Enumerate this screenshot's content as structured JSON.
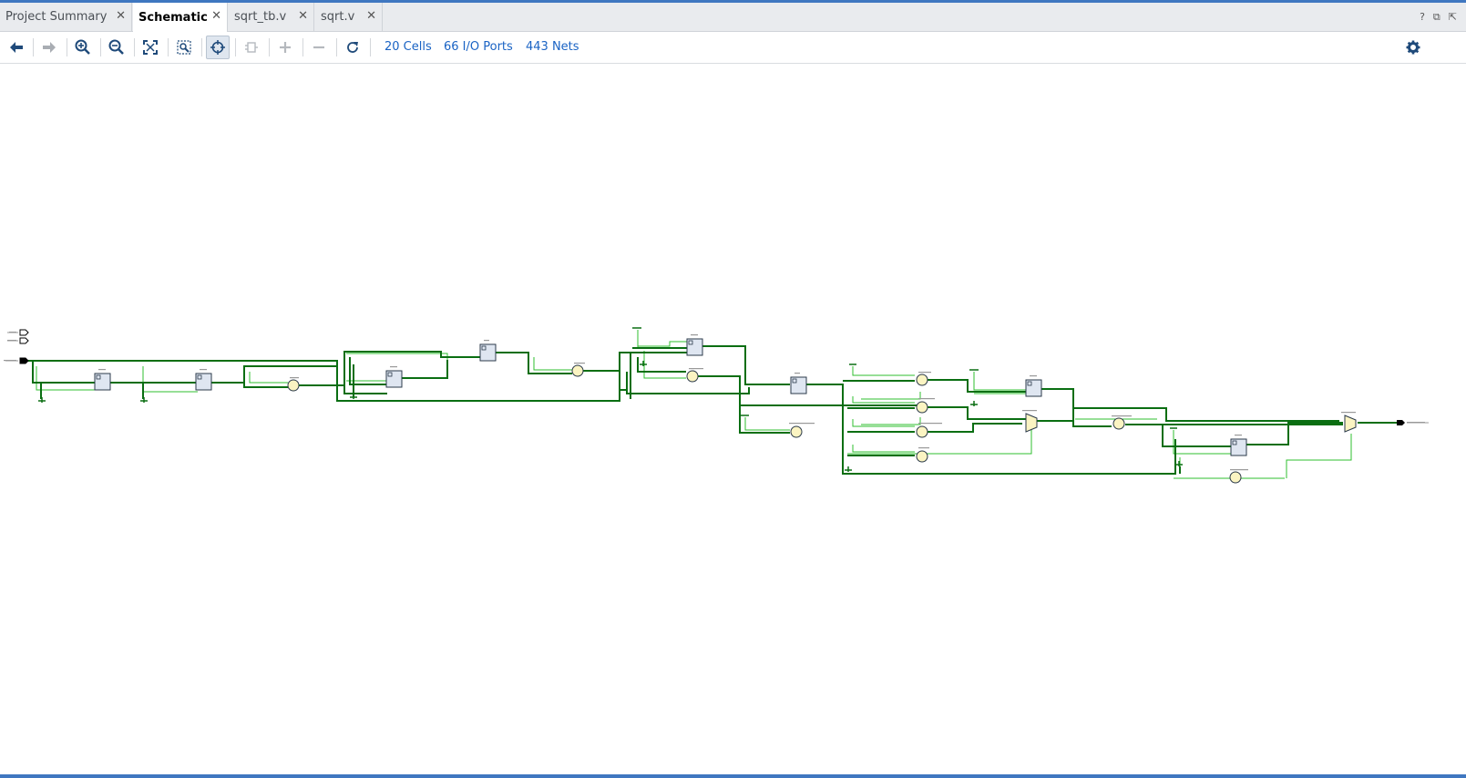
{
  "tabs": [
    {
      "label": "Project Summary",
      "active": false
    },
    {
      "label": "Schematic",
      "active": true
    },
    {
      "label": "sqrt_tb.v",
      "active": false
    },
    {
      "label": "sqrt.v",
      "active": false
    }
  ],
  "window_icons": [
    "help-icon",
    "restore-icon",
    "float-icon"
  ],
  "toolbar": {
    "buttons": [
      "back-icon",
      "forward-icon",
      "zoom-in-icon",
      "zoom-out-icon",
      "zoom-fit-icon",
      "zoom-area-icon",
      "select-icon",
      "regenerate-icon",
      "expand-icon",
      "collapse-icon",
      "reload-icon"
    ],
    "cells": "20 Cells",
    "ports": "66 I/O Ports",
    "nets": "443 Nets",
    "settings": "gear-icon"
  },
  "colors": {
    "accent": "#1a63c4",
    "net_dark": "#0a6e12",
    "net_light": "#2fbf2f",
    "register_fill": "#dfe6f1",
    "operator_fill": "#fbf4c2"
  }
}
